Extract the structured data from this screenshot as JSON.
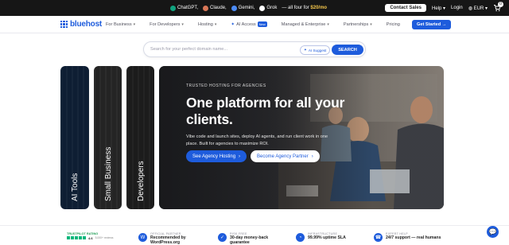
{
  "promo": {
    "ai_tools": [
      {
        "name": "ChatGPT,",
        "color": "#10a37f",
        "icon": "chatgpt-icon"
      },
      {
        "name": "Claude,",
        "color": "#d97757",
        "icon": "claude-icon"
      },
      {
        "name": "Gemini,",
        "color": "#4b8bf5",
        "icon": "gemini-icon"
      },
      {
        "name": "Grok",
        "color": "#ffffff",
        "icon": "grok-icon"
      }
    ],
    "deal_prefix": "— all four for",
    "deal_price": "$20/mo",
    "contact_sales": "Contact Sales",
    "help": "Help ▾",
    "login": "Login",
    "currency": "EUR ▾",
    "cart_count": "0"
  },
  "nav": {
    "logo": "bluehost",
    "items": [
      {
        "label": "For Business",
        "chevron": "▾"
      },
      {
        "label": "For Developers",
        "chevron": "▾"
      },
      {
        "label": "Hosting",
        "chevron": "▾"
      },
      {
        "label": "AI Access",
        "badge": "New"
      },
      {
        "label": "Managed & Enterprise",
        "chevron": "▾"
      },
      {
        "label": "Partnerships",
        "chevron": "▾"
      },
      {
        "label": "Pricing"
      }
    ],
    "cta": "Get Started →"
  },
  "search": {
    "placeholder": "Search for your perfect domain name...",
    "ai_suggest": "AI Suggest",
    "button": "SEARCH"
  },
  "cards": [
    {
      "label": "AI Tools"
    },
    {
      "label": "Small Business"
    },
    {
      "label": "Developers"
    }
  ],
  "hero": {
    "eyebrow": "TRUSTED HOSTING FOR AGENCIES",
    "headline": "One platform for all your clients.",
    "description": "Vibe code and launch sites, deploy AI agents, and run client work in one place. Built for agencies to maximize ROI.",
    "primary_cta": "See Agency Hosting",
    "secondary_cta": "Become Agency Partner"
  },
  "strip": {
    "trustpilot_label": "TRUSTPILOT RATING",
    "trustpilot_score": "4.6",
    "trustpilot_reviews": "5,000+ reviews",
    "features": [
      {
        "small": "OFFICIAL PARTNER",
        "big": "Recommended by WordPress.org",
        "icon": "wordpress-icon",
        "glyph": "W"
      },
      {
        "small": "RISK FREE",
        "big": "30-day money-back guarantee",
        "icon": "shield-icon",
        "glyph": "✓"
      },
      {
        "small": "INFRASTRUCTURE",
        "big": "99.99% uptime SLA",
        "icon": "speedometer-icon",
        "glyph": "◔"
      },
      {
        "small": "EXPERT HELP",
        "big": "24/7 support — real humans",
        "icon": "headset-icon",
        "glyph": "☎"
      }
    ]
  },
  "colors": {
    "brand": "#1e5cdc",
    "promo_bg": "#161616",
    "price": "#f3c54a"
  }
}
